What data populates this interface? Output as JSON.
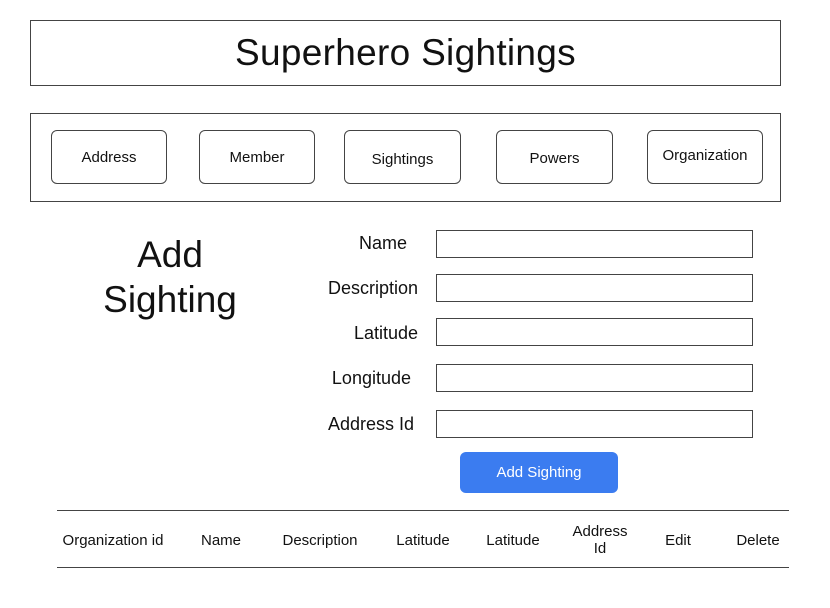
{
  "header": {
    "title": "Superhero Sightings"
  },
  "nav": {
    "items": [
      {
        "label": "Address"
      },
      {
        "label": "Member"
      },
      {
        "label": "Sightings"
      },
      {
        "label": "Powers"
      },
      {
        "label": "Organization"
      }
    ]
  },
  "page": {
    "title_line1": "Add",
    "title_line2": "Sighting"
  },
  "form": {
    "fields": [
      {
        "label": "Name",
        "value": ""
      },
      {
        "label": "Description",
        "value": ""
      },
      {
        "label": "Latitude",
        "value": ""
      },
      {
        "label": "Longitude",
        "value": ""
      },
      {
        "label": "Address Id",
        "value": ""
      }
    ],
    "submit_label": "Add Sighting"
  },
  "table": {
    "columns": [
      {
        "label": "Organization id"
      },
      {
        "label": "Name"
      },
      {
        "label": "Description"
      },
      {
        "label": "Latitude"
      },
      {
        "label": "Latitude"
      },
      {
        "label_line1": "Address",
        "label_line2": "Id"
      },
      {
        "label": "Edit"
      },
      {
        "label": "Delete"
      }
    ]
  }
}
